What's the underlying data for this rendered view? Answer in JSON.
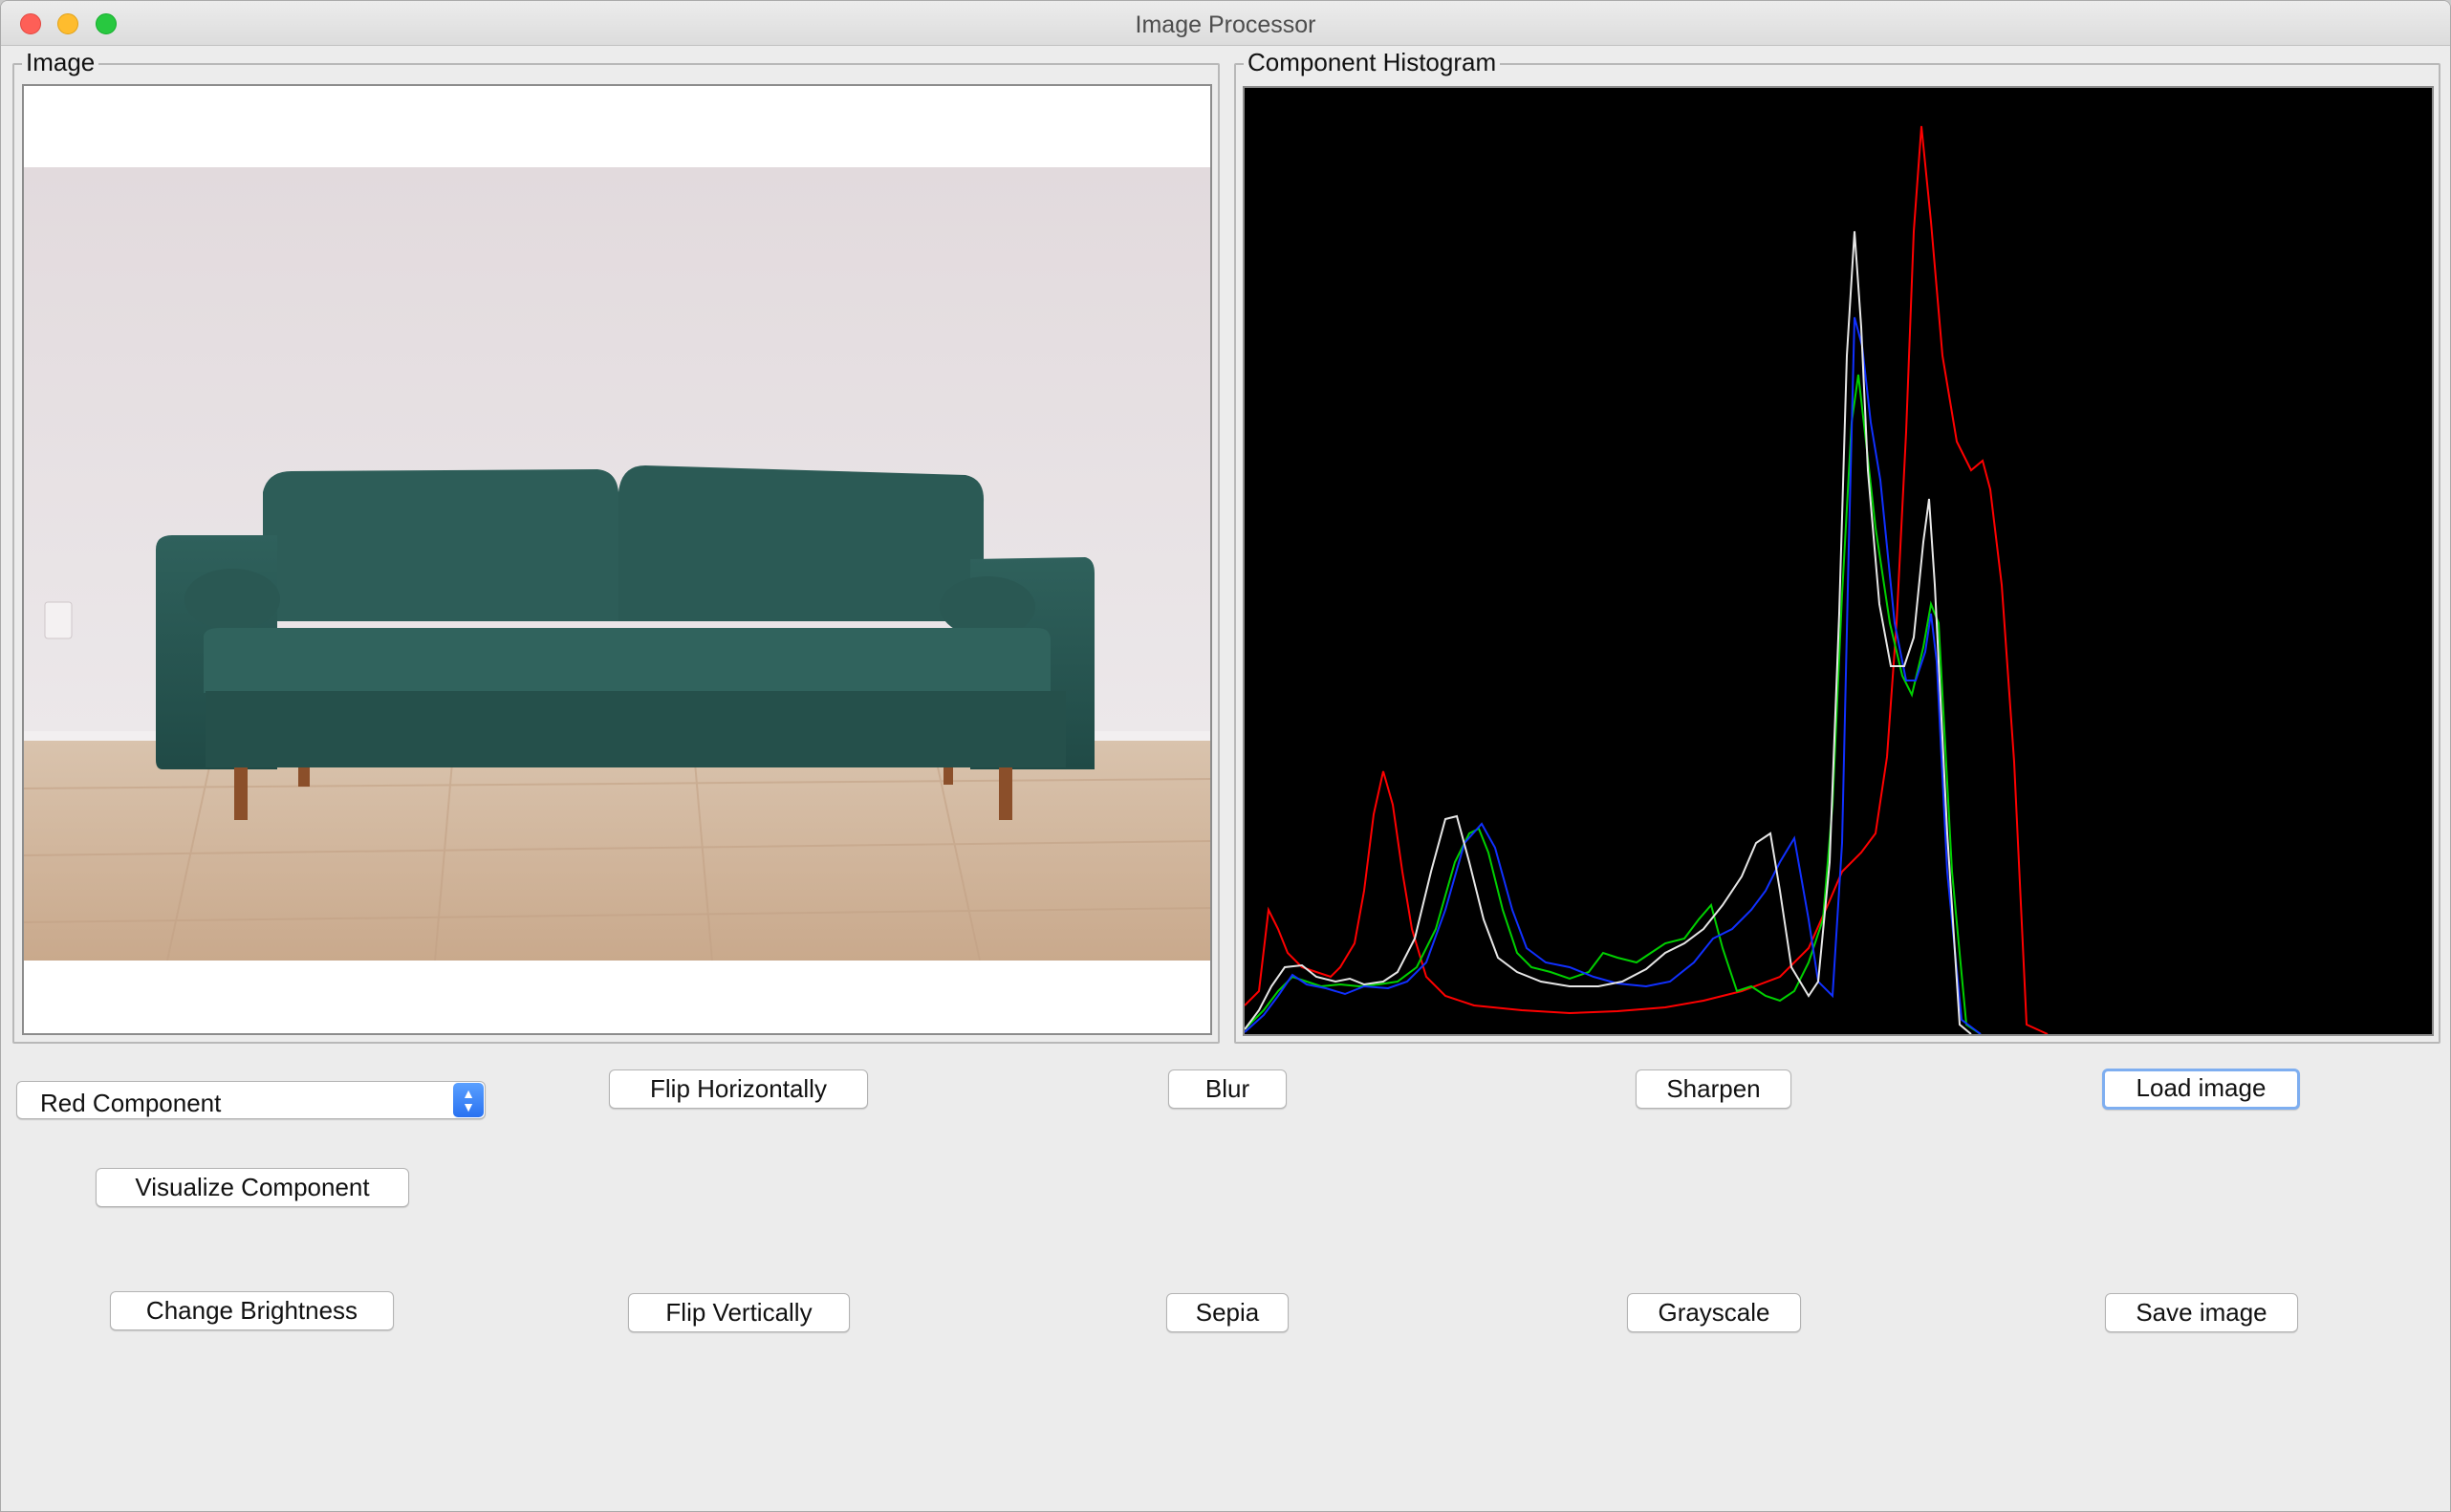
{
  "window": {
    "title": "Image Processor"
  },
  "image_panel": {
    "label": "Image"
  },
  "histogram_panel": {
    "label": "Component Histogram",
    "series_colors": [
      "#ff0000",
      "#00d000",
      "#1030ff",
      "#e6e6e6"
    ]
  },
  "component_select": {
    "value": "Red Component"
  },
  "buttons": {
    "visualize": "Visualize Component",
    "change_brightness": "Change Brightness",
    "flip_horizontally": "Flip Horizontally",
    "flip_vertically": "Flip Vertically",
    "blur": "Blur",
    "sepia": "Sepia",
    "sharpen": "Sharpen",
    "grayscale": "Grayscale",
    "load_image": "Load image",
    "save_image": "Save image"
  }
}
